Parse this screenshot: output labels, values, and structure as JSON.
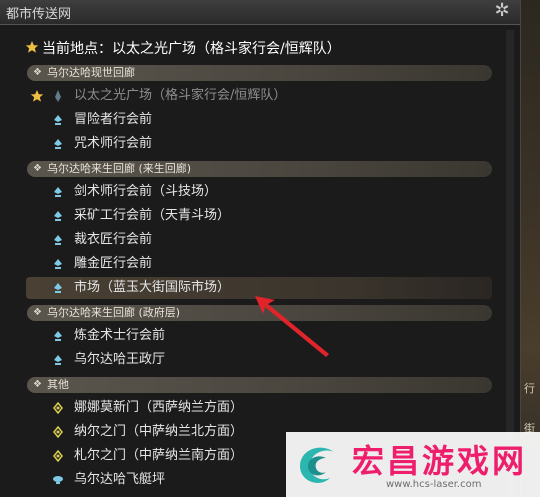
{
  "window": {
    "title": "都市传送网"
  },
  "current_location": "当前地点：以太之光广场（格斗家行会/恒辉队）",
  "sections": [
    {
      "label": "乌尔达哈现世回廊",
      "items": [
        {
          "label": "以太之光广场（格斗家行会/恒辉队）",
          "favorite": true,
          "disabled": true,
          "icon": "aetheryte-plaza-icon"
        },
        {
          "label": "冒险者行会前",
          "icon": "aetheryte-shard-icon"
        },
        {
          "label": "咒术师行会前",
          "icon": "aetheryte-shard-icon"
        }
      ]
    },
    {
      "label": "乌尔达哈来生回廊 (来生回廊)",
      "items": [
        {
          "label": "剑术师行会前（斗技场）",
          "icon": "aetheryte-shard-icon"
        },
        {
          "label": "采矿工行会前（天青斗场）",
          "icon": "aetheryte-shard-icon"
        },
        {
          "label": "裁衣匠行会前",
          "icon": "aetheryte-shard-icon"
        },
        {
          "label": "雕金匠行会前",
          "icon": "aetheryte-shard-icon"
        },
        {
          "label": "市场（蓝玉大街国际市场）",
          "icon": "aetheryte-shard-icon",
          "highlighted": true
        }
      ]
    },
    {
      "label": "乌尔达哈来生回廊 (政府层)",
      "items": [
        {
          "label": "炼金术士行会前",
          "icon": "aetheryte-shard-icon"
        },
        {
          "label": "乌尔达哈王政厅",
          "icon": "aetheryte-shard-icon"
        }
      ]
    },
    {
      "label": "其他",
      "items": [
        {
          "label": "娜娜莫新门（西萨纳兰方面）",
          "icon": "gate-icon"
        },
        {
          "label": "纳尔之门（中萨纳兰北方面）",
          "icon": "gate-icon"
        },
        {
          "label": "札尔之门（中萨纳兰南方面）",
          "icon": "gate-icon"
        },
        {
          "label": "乌尔达哈飞艇坪",
          "icon": "airship-icon"
        }
      ]
    }
  ],
  "watermark": {
    "brand": "宏昌游戏网",
    "url": "www.hcs-laser.com"
  },
  "side": {
    "text1": "行",
    "text2": "街"
  },
  "colors": {
    "star": "#f0c040",
    "shard": "#7ec9e6",
    "gate": "#d8d24a",
    "watermark": "#ee1e6d"
  }
}
